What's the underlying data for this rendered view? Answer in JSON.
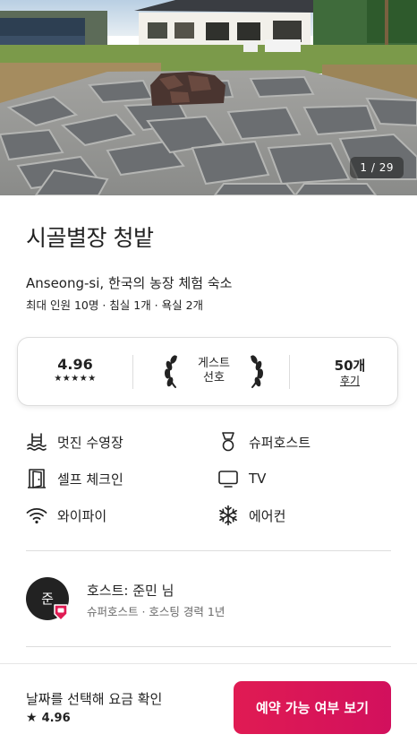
{
  "listing": {
    "photo_counter": "1 / 29",
    "title": "시골별장 청밭",
    "subtitle": "Anseong-si, 한국의 농장 체험 숙소",
    "capacity": "최대 인원 10명 · 침실 1개 · 욕실 2개"
  },
  "rating_card": {
    "score": "4.96",
    "stars": "★★★★★",
    "guest_favorite_line1": "게스트",
    "guest_favorite_line2": "선호",
    "reviews_count": "50개",
    "reviews_label": "후기"
  },
  "amenities": [
    {
      "icon": "pool-icon",
      "label": "멋진 수영장"
    },
    {
      "icon": "superhost-medal-icon",
      "label": "슈퍼호스트"
    },
    {
      "icon": "door-icon",
      "label": "셀프 체크인"
    },
    {
      "icon": "tv-icon",
      "label": "TV"
    },
    {
      "icon": "wifi-icon",
      "label": "와이파이"
    },
    {
      "icon": "snowflake-icon",
      "label": "에어컨"
    }
  ],
  "host": {
    "avatar_initial": "준",
    "name": "호스트: 준민 님",
    "meta": "슈퍼호스트 · 호스팅 경력 1년"
  },
  "footer": {
    "price_prompt": "날짜를 선택해 요금 확인",
    "rating_star": "★",
    "rating": "4.96",
    "reserve_button": "예약 가능 여부 보기"
  },
  "colors": {
    "brand": "#e01b53",
    "text": "#222222",
    "muted": "#6a6a6a",
    "border": "#dddddd"
  }
}
